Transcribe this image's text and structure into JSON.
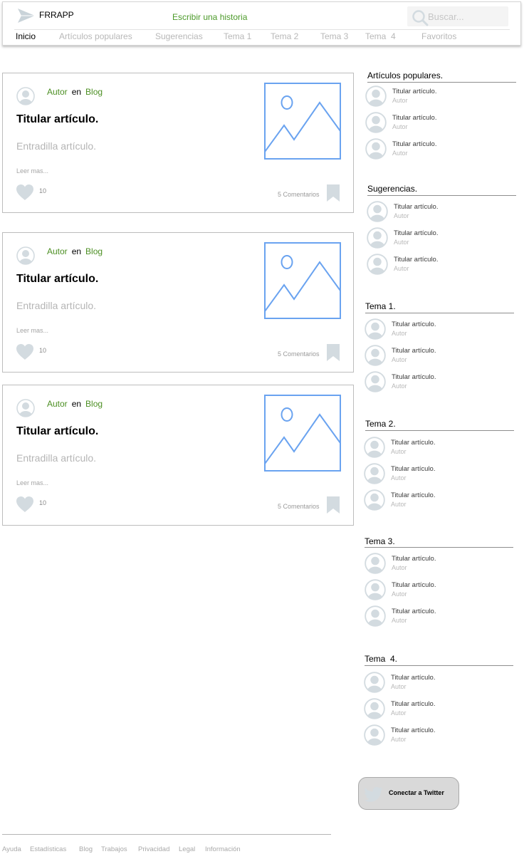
{
  "header": {
    "app_name": "FRRAPP",
    "write_link": "Escribir una historia",
    "search_placeholder": "Buscar...",
    "nav": [
      "Inicio",
      "Artículos populares",
      "Sugerencias",
      "Tema 1",
      "Tema 2",
      "Tema 3",
      "Tema  4",
      "Favoritos"
    ],
    "active_nav": "Inicio"
  },
  "cards": [
    {
      "author": "Autor",
      "en": "en",
      "blog": "Blog",
      "title": "Titular artículo.",
      "subtitle": "Entradilla artículo.",
      "read_more": "Leer mas...",
      "likes": "10",
      "comments": "5 Comentarios"
    },
    {
      "author": "Autor",
      "en": "en",
      "blog": "Blog",
      "title": "Titular artículo.",
      "subtitle": "Entradilla artículo.",
      "read_more": "Leer mas...",
      "likes": "10",
      "comments": "5 Comentarios"
    },
    {
      "author": "Autor",
      "en": "en",
      "blog": "Blog",
      "title": "Titular artículo.",
      "subtitle": "Entradilla artículo.",
      "read_more": "Leer mas...",
      "likes": "10",
      "comments": "5 Comentarios"
    }
  ],
  "sidebar": {
    "sections": [
      {
        "heading": "Artículos populares.",
        "items": [
          {
            "title": "Titular artículo.",
            "author": "Autor"
          },
          {
            "title": "Titular artículo.",
            "author": "Autor"
          },
          {
            "title": "Titular artículo.",
            "author": "Autor"
          }
        ]
      },
      {
        "heading": "Sugerencias.",
        "items": [
          {
            "title": "Titular artículo.",
            "author": "Autor"
          },
          {
            "title": "Titular artículo.",
            "author": "Autor"
          },
          {
            "title": "Titular artículo.",
            "author": "Autor"
          }
        ]
      },
      {
        "heading": "Tema 1.",
        "items": [
          {
            "title": "Titular artículo.",
            "author": "Autor"
          },
          {
            "title": "Titular artículo.",
            "author": "Autor"
          },
          {
            "title": "Titular artículo.",
            "author": "Autor"
          }
        ]
      },
      {
        "heading": "Tema 2.",
        "items": [
          {
            "title": "Titular artículo.",
            "author": "Autor"
          },
          {
            "title": "Titular artículo.",
            "author": "Autor"
          },
          {
            "title": "Titular artículo.",
            "author": "Autor"
          }
        ]
      },
      {
        "heading": "Tema 3.",
        "items": [
          {
            "title": "Titular artículo.",
            "author": "Autor"
          },
          {
            "title": "Titular artículo.",
            "author": "Autor"
          },
          {
            "title": "Titular artículo.",
            "author": "Autor"
          }
        ]
      },
      {
        "heading": "Tema  4.",
        "items": [
          {
            "title": "Titular artículo.",
            "author": "Autor"
          },
          {
            "title": "Titular artículo.",
            "author": "Autor"
          },
          {
            "title": "Titular artículo.",
            "author": "Autor"
          }
        ]
      }
    ],
    "twitter_button": "Conectar a Twitter"
  },
  "footer": {
    "links": [
      "Ayuda",
      "Estadísticas",
      "Blog",
      "Trabajos",
      "Privacidad",
      "Legal",
      "Información"
    ]
  },
  "icons": {
    "logo": "paper-plane-icon",
    "search": "search-icon",
    "avatar": "user-avatar-icon",
    "image": "image-placeholder-icon",
    "like": "heart-icon",
    "bookmark": "bookmark-icon",
    "twitter": "twitter-bird-icon"
  },
  "colors": {
    "accent_green": "#4c8f23",
    "placeholder_blue": "#6aa3f0",
    "icon_grey": "#d3dbe0"
  }
}
